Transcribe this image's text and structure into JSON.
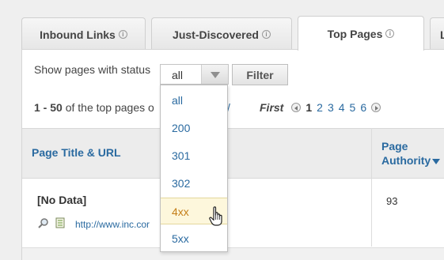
{
  "tabs": [
    {
      "label": "Inbound Links",
      "info": "i"
    },
    {
      "label": "Just-Discovered",
      "info": "i"
    },
    {
      "label": "Top Pages",
      "info": "i"
    },
    {
      "label": "L",
      "info": ""
    }
  ],
  "filter": {
    "label": "Show pages with status",
    "selected": "all",
    "button_label": "Filter"
  },
  "results": {
    "range": "1 - 50",
    "text_a": "of the top pages o",
    "link": "/"
  },
  "pager": {
    "first_label": "First",
    "current": "1",
    "pages": [
      "2",
      "3",
      "4",
      "5",
      "6"
    ]
  },
  "table": {
    "col_title": "Page Title & URL",
    "col_pa_line1": "Page",
    "col_pa_line2": "Authority",
    "rows": [
      {
        "title": "[No Data]",
        "url": "http://www.inc.cor",
        "authority": "93"
      }
    ]
  },
  "dropdown": {
    "options": [
      "all",
      "200",
      "301",
      "302",
      "4xx",
      "5xx"
    ],
    "hovered": "4xx"
  },
  "colors": {
    "link": "#2a6aa0",
    "hover_bg": "#fdf7dc",
    "hover_text": "#c47e18"
  }
}
